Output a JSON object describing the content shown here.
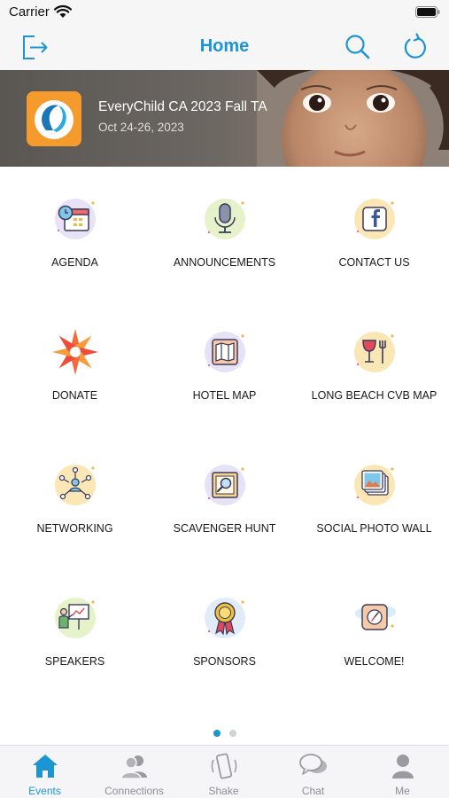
{
  "status_bar": {
    "carrier": "Carrier"
  },
  "nav": {
    "title": "Home",
    "left_icon": "logout-icon",
    "right_icons": [
      "search-icon",
      "refresh-icon"
    ]
  },
  "event": {
    "title": "EveryChild CA 2023 Fall TA",
    "dates": "Oct 24-26, 2023"
  },
  "modules": [
    {
      "label": "AGENDA",
      "icon": "calendar-clock-icon"
    },
    {
      "label": "ANNOUNCEMENTS",
      "icon": "microphone-icon"
    },
    {
      "label": "CONTACT US",
      "icon": "facebook-icon"
    },
    {
      "label": "DONATE",
      "icon": "starburst-logo-icon"
    },
    {
      "label": "HOTEL MAP",
      "icon": "map-icon"
    },
    {
      "label": "LONG BEACH CVB MAP",
      "icon": "wine-fork-icon"
    },
    {
      "label": "NETWORKING",
      "icon": "network-icon"
    },
    {
      "label": "SCAVENGER HUNT",
      "icon": "magnifier-icon"
    },
    {
      "label": "SOCIAL PHOTO WALL",
      "icon": "photos-icon"
    },
    {
      "label": "SPEAKERS",
      "icon": "presenter-icon"
    },
    {
      "label": "SPONSORS",
      "icon": "award-ribbon-icon"
    },
    {
      "label": "WELCOME!",
      "icon": "welcome-compass-icon"
    }
  ],
  "pagination": {
    "pages": 2,
    "current": 1
  },
  "tabs": [
    {
      "label": "Events",
      "icon": "home-icon",
      "active": true
    },
    {
      "label": "Connections",
      "icon": "people-icon",
      "active": false
    },
    {
      "label": "Shake",
      "icon": "phone-shake-icon",
      "active": false
    },
    {
      "label": "Chat",
      "icon": "chat-bubbles-icon",
      "active": false
    },
    {
      "label": "Me",
      "icon": "person-icon",
      "active": false
    }
  ],
  "colors": {
    "accent": "#1b95d3",
    "tab_inactive": "#8e8e93",
    "nav_bg": "#f7f6f7"
  }
}
